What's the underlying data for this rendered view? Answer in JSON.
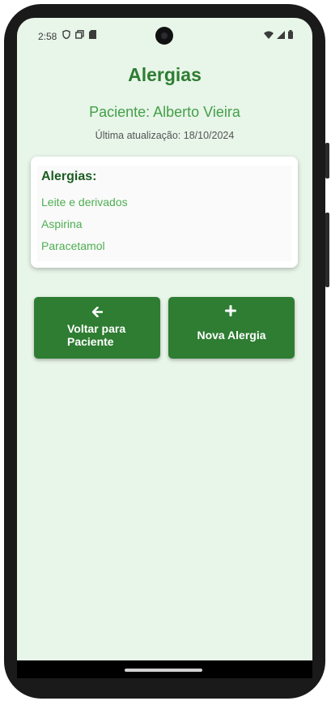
{
  "status_bar": {
    "time": "2:58",
    "left_icons": [
      "shield-icon",
      "screen-copy-icon",
      "sd-card-icon"
    ],
    "right_icons": [
      "wifi-icon",
      "signal-icon",
      "battery-icon"
    ]
  },
  "page": {
    "title": "Alergias",
    "patient_label": "Paciente: Alberto Vieira",
    "last_update": "Última atualização: 18/10/2024"
  },
  "allergies_card": {
    "heading": "Alergias:",
    "items": [
      "Leite e derivados",
      "Aspirina",
      "Paracetamol"
    ]
  },
  "buttons": {
    "back": {
      "icon": "arrow-left-icon",
      "label_line1": "Voltar para",
      "label_line2": "Paciente"
    },
    "add": {
      "icon": "plus-icon",
      "label": "Nova Alergia"
    }
  },
  "colors": {
    "background": "#e8f5e9",
    "primary": "#2e7d32",
    "accent": "#4caf50",
    "heading_dark": "#1b5e20"
  }
}
